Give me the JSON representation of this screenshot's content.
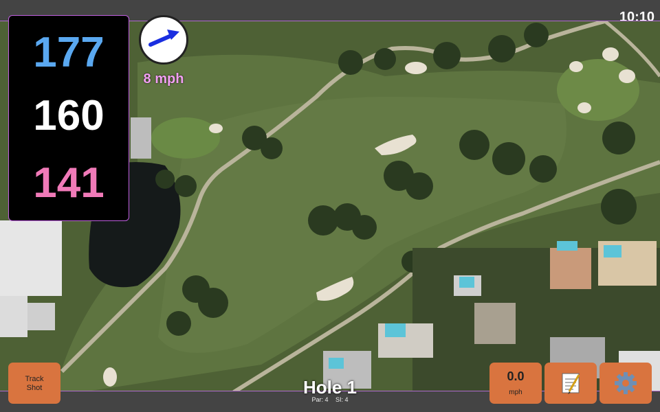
{
  "status": {
    "time": "10:10"
  },
  "distances": {
    "back": "177",
    "middle": "160",
    "front": "141"
  },
  "wind": {
    "speed": "8 mph",
    "direction_icon": "wind-arrow-icon"
  },
  "hole": {
    "title": "Hole 1",
    "par": "Par: 4",
    "si": "SI: 4"
  },
  "buttons": {
    "track_shot": "Track\nShot",
    "speed_value": "0.0",
    "speed_unit": "mph",
    "notes_icon": "notepad-icon",
    "settings_icon": "gear-icon"
  },
  "colors": {
    "accent_back": "#5aa8f0",
    "accent_front": "#f07ab8",
    "button_bg": "#d9743f",
    "wind_arrow": "#1a2ee0"
  }
}
